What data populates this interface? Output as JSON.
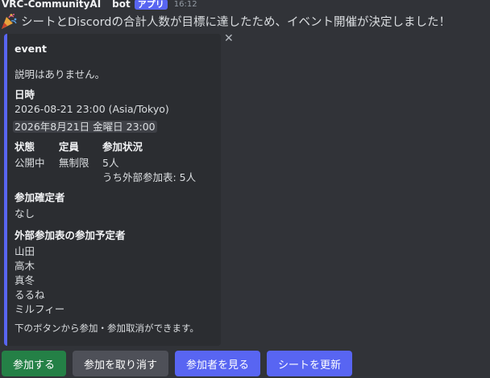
{
  "message": {
    "author": "VRC-CommunityAI",
    "bot_name": "bot",
    "badge": "アプリ",
    "timestamp": "16:12",
    "text": "シートとDiscordの合計人数が目標に達したため、イベント開催が決定しました！",
    "emoji_icon": "party-popper-icon"
  },
  "embed": {
    "accent_color": "#5865f2",
    "title": "event",
    "description": "説明はありません。",
    "datetime_label": "日時",
    "datetime_raw": "2026-08-21 23:00 (Asia/Tokyo)",
    "datetime_local": "2026年8月21日 金曜日 23:00",
    "status_label": "状態",
    "status_value": "公開中",
    "capacity_label": "定員",
    "capacity_value": "無制限",
    "participation_label": "参加状況",
    "participation_value": "5人",
    "participation_external": "うち外部参加表: 5人",
    "confirmed_label": "参加確定者",
    "confirmed_value": "なし",
    "external_label": "外部参加表の参加予定者",
    "external_names": [
      "山田",
      "高木",
      "真冬",
      "るるね",
      "ミルフィー"
    ],
    "footer": "下のボタンから参加・参加取消ができます。"
  },
  "buttons": {
    "join": "参加する",
    "cancel": "参加を取り消す",
    "view": "参加者を見る",
    "refresh": "シートを更新"
  }
}
